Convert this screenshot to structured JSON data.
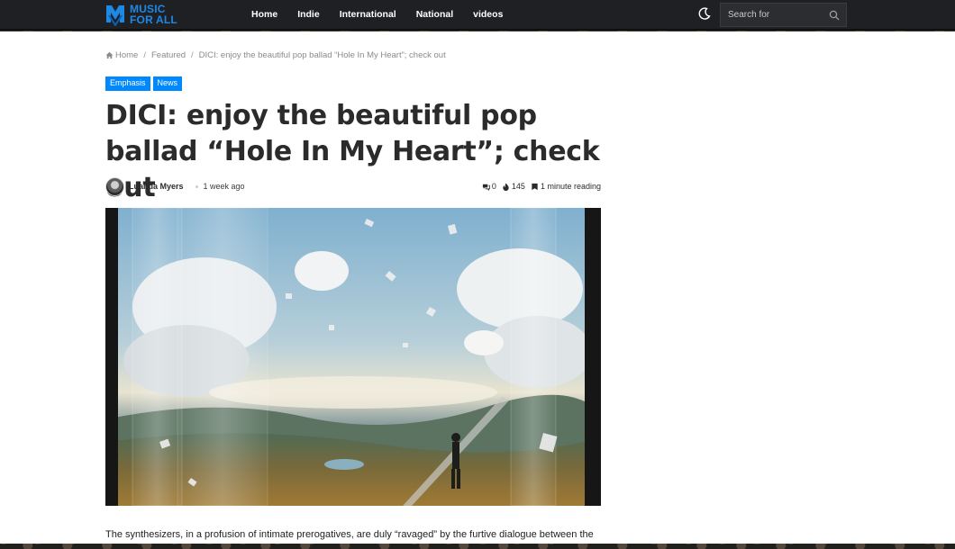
{
  "brand": {
    "logo_line1": "MUSIC",
    "logo_line2": "FOR ALL",
    "accent_color": "#1e88e5"
  },
  "nav": {
    "items": [
      {
        "label": "Home"
      },
      {
        "label": "Indie"
      },
      {
        "label": "International"
      },
      {
        "label": "National"
      },
      {
        "label": "videos"
      }
    ],
    "search_placeholder": "Search for",
    "dark_mode_icon": "moon-icon",
    "search_icon": "search-icon"
  },
  "breadcrumb": {
    "home": "Home",
    "featured": "Featured",
    "current": "DICI: enjoy the beautiful pop ballad “Hole In My Heart”; check out"
  },
  "badges": [
    "Emphasis",
    "News"
  ],
  "badge_color": "#0088ff",
  "article": {
    "title": "DICI: enjoy the beautiful pop ballad “Hole In My Heart”; check out",
    "author": "Luanda Myers",
    "date": "1 week ago",
    "comments": "0",
    "views": "145",
    "reading_time": "1 minute reading",
    "body_start": "The synthesizers, in a profusion of intimate prerogatives, are duly “ravaged” by the furtive dialogue between the"
  }
}
